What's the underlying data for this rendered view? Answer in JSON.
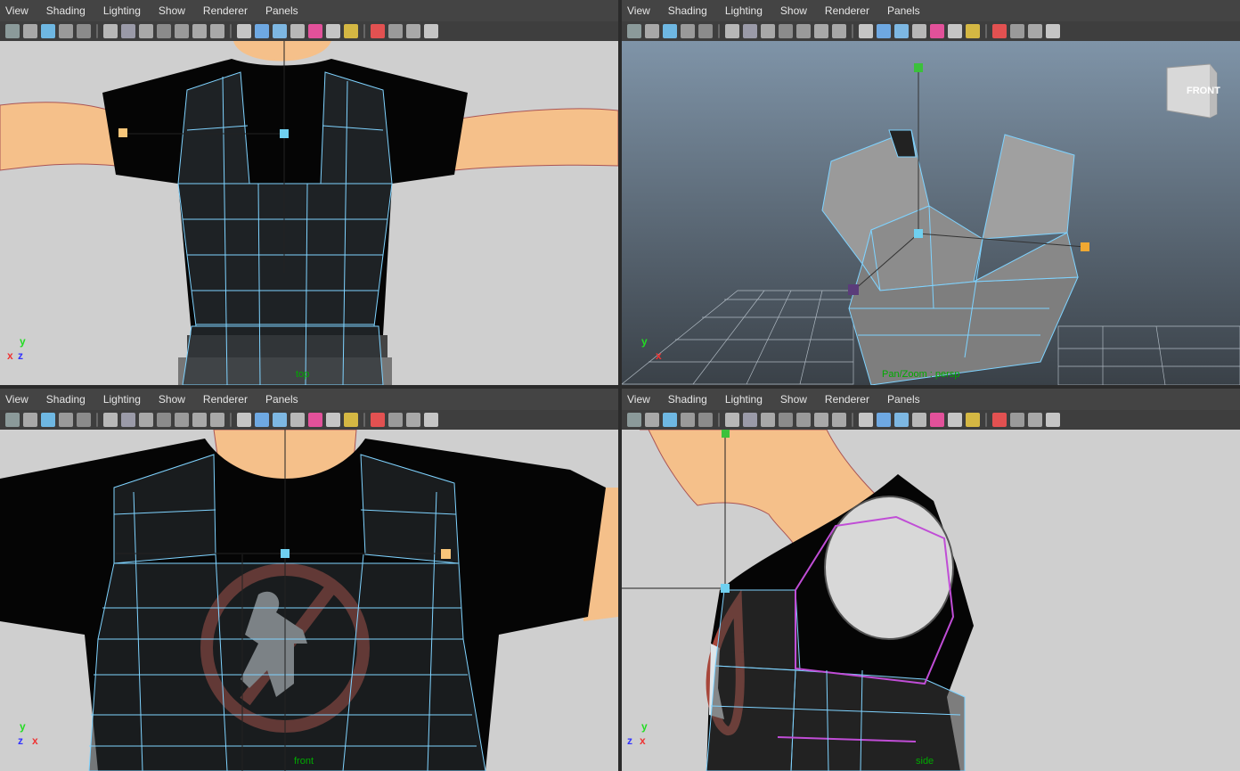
{
  "menu": [
    "View",
    "Shading",
    "Lighting",
    "Show",
    "Renderer",
    "Panels"
  ],
  "toolbar_icons": [
    "select-camera",
    "lock-camera",
    "camera-attributes",
    "bookmarks",
    "image-plane",
    "grid",
    "film-gate",
    "resolution-gate",
    "gate-mask",
    "field-chart",
    "safe-action",
    "safe-title",
    "wireframe",
    "smooth-shade",
    "flat-shade",
    "textured",
    "use-all-lights",
    "shadows",
    "ambient-occlusion",
    "isolate-select",
    "xray",
    "xray-joints",
    "xray-components"
  ],
  "panels": {
    "top": {
      "camera_label": "top",
      "axes": {
        "y": "y",
        "h": "x",
        "v": "z"
      }
    },
    "persp": {
      "camera_label": "Pan/Zoom : persp",
      "viewcube_label": "FRONT",
      "axes": {
        "y": "y",
        "x": "x"
      }
    },
    "front": {
      "camera_label": "front",
      "axes": {
        "y": "y",
        "h": "z",
        "v": "x"
      }
    },
    "side": {
      "camera_label": "side",
      "axes": {
        "y": "y",
        "h": "z",
        "v": "x"
      }
    }
  },
  "colors": {
    "menubar": "#444444",
    "viewport_bg": "#cfcfcf",
    "wire": "#7fd3ff",
    "shirt": "#050505",
    "skin": "#f5c08a",
    "pivot": "#6fd0f0",
    "handle": "#f8c67a",
    "selected_edge": "#c04dd6"
  }
}
